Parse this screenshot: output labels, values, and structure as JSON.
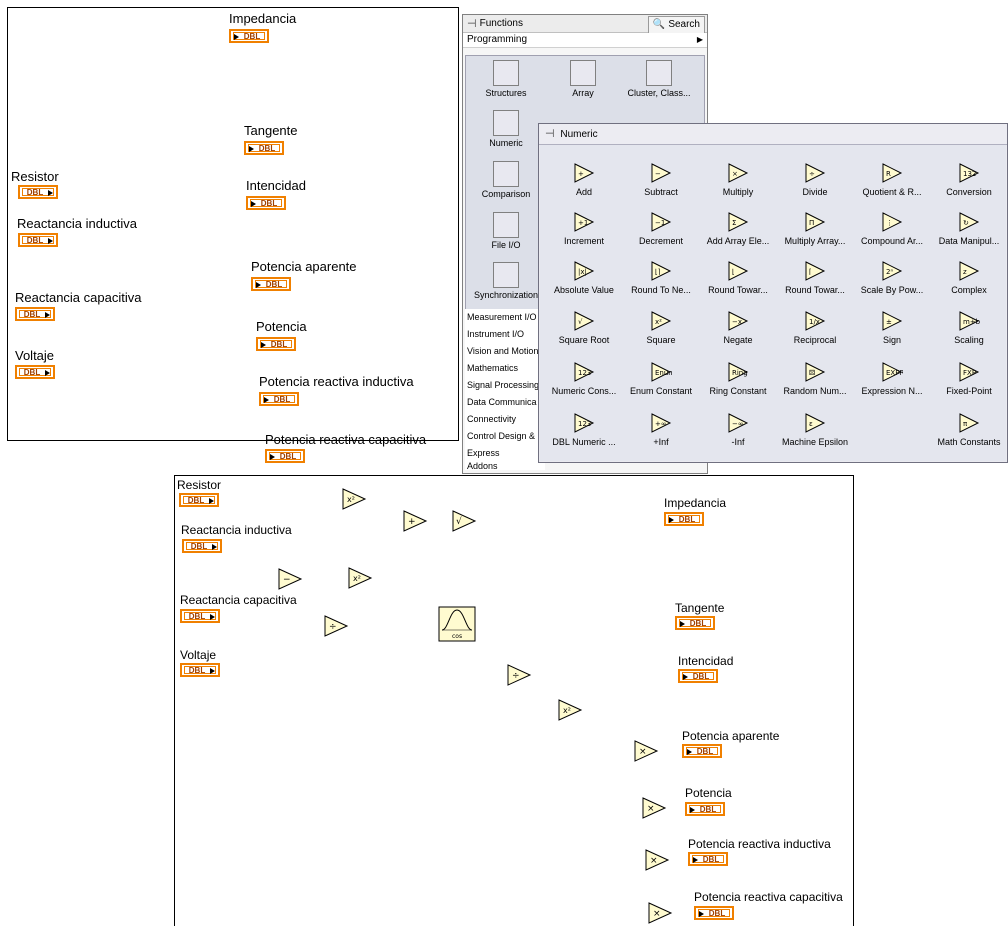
{
  "front_panel": {
    "controls": [
      {
        "name": "resistor",
        "label": "Resistor",
        "type": "DBL"
      },
      {
        "name": "reactancia-inductiva",
        "label": "Reactancia inductiva",
        "type": "DBL"
      },
      {
        "name": "reactancia-capacitiva",
        "label": "Reactancia capacitiva",
        "type": "DBL"
      },
      {
        "name": "voltaje",
        "label": "Voltaje",
        "type": "DBL"
      }
    ],
    "indicators": [
      {
        "name": "impedancia",
        "label": "Impedancia",
        "type": "DBL"
      },
      {
        "name": "tangente",
        "label": "Tangente",
        "type": "DBL"
      },
      {
        "name": "intencidad",
        "label": "Intencidad",
        "type": "DBL"
      },
      {
        "name": "potencia-aparente",
        "label": "Potencia aparente",
        "type": "DBL"
      },
      {
        "name": "potencia",
        "label": "Potencia",
        "type": "DBL"
      },
      {
        "name": "potencia-reactiva-inductiva",
        "label": "Potencia reactiva inductiva",
        "type": "DBL"
      },
      {
        "name": "potencia-reactiva-capacitiva",
        "label": "Potencia reactiva capacitiva",
        "type": "DBL"
      }
    ]
  },
  "functions_palette": {
    "title": "Functions",
    "search_label": "Search",
    "subtitle": "Programming",
    "categories": [
      {
        "label": "Structures",
        "icon": "structures-icon"
      },
      {
        "label": "Array",
        "icon": "array-icon"
      },
      {
        "label": "Cluster, Class...",
        "icon": "cluster-icon"
      },
      {
        "label": "Numeric",
        "icon": "numeric-icon"
      },
      {
        "label": "Comparison",
        "icon": "comparison-icon"
      },
      {
        "label": "File I/O",
        "icon": "file-io-icon"
      },
      {
        "label": "Synchronization",
        "icon": "synchronization-icon"
      }
    ],
    "list": [
      "Measurement I/O",
      "Instrument I/O",
      "Vision and Motion",
      "Mathematics",
      "Signal Processing",
      "Data Communica",
      "Connectivity",
      "Control Design &",
      "Express",
      "Addons"
    ]
  },
  "numeric_palette": {
    "title": "Numeric",
    "items": [
      "Add",
      "Subtract",
      "Multiply",
      "Divide",
      "Quotient & R...",
      "Conversion",
      "Increment",
      "Decrement",
      "Add Array Ele...",
      "Multiply Array...",
      "Compound Ar...",
      "Data Manipul...",
      "Absolute Value",
      "Round To Ne...",
      "Round Towar...",
      "Round Towar...",
      "Scale By Pow...",
      "Complex",
      "Square Root",
      "Square",
      "Negate",
      "Reciprocal",
      "Sign",
      "Scaling",
      "Numeric Cons...",
      "Enum Constant",
      "Ring Constant",
      "Random Num...",
      "Expression N...",
      "Fixed-Point",
      "DBL Numeric ...",
      "+Inf",
      "-Inf",
      "Machine Epsilon",
      "",
      "Math Constants"
    ]
  },
  "block_diagram": {
    "controls": [
      "Resistor",
      "Reactancia inductiva",
      "Reactancia capacitiva",
      "Voltaje"
    ],
    "indicators": [
      "Impedancia",
      "Tangente",
      "Intencidad",
      "Potencia aparente",
      "Potencia",
      "Potencia reactiva inductiva",
      "Potencia reactiva capacitiva"
    ],
    "terminal_type": "DBL",
    "function_nodes": [
      "square",
      "add",
      "square-root",
      "subtract",
      "square",
      "divide",
      "cosine",
      "divide",
      "square",
      "multiply",
      "multiply",
      "multiply",
      "multiply"
    ]
  },
  "colors": {
    "dbl_orange": "#f08000",
    "palette_bg": "#e4e6ee"
  }
}
